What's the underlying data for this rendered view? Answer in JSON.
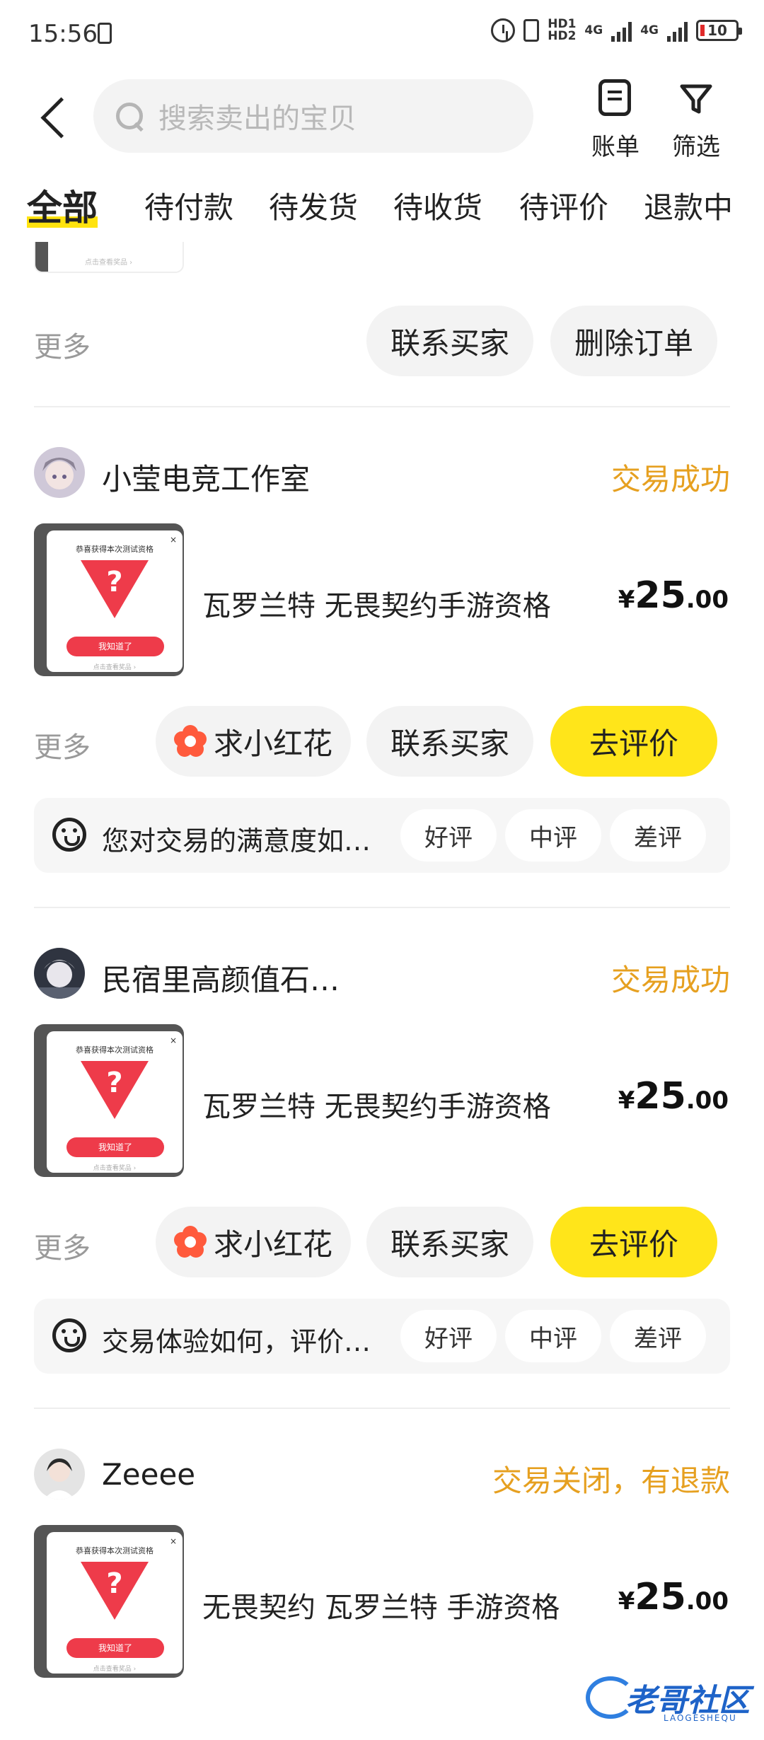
{
  "status_bar": {
    "time": "15:56",
    "hd1": "HD1",
    "hd2": "HD2",
    "net1": "4G",
    "net2": "4G",
    "battery": "10"
  },
  "header": {
    "search_placeholder": "搜索卖出的宝贝",
    "bill_label": "账单",
    "filter_label": "筛选"
  },
  "tabs": [
    {
      "label": "全部",
      "active": true
    },
    {
      "label": "待付款"
    },
    {
      "label": "待发货"
    },
    {
      "label": "待收货"
    },
    {
      "label": "待评价"
    },
    {
      "label": "退款中"
    }
  ],
  "top_partial": {
    "thumb_caption": "点击查看奖品 ›",
    "more": "更多",
    "contact": "联系买家",
    "delete": "删除订单"
  },
  "orders": [
    {
      "seller": "小莹电竞工作室",
      "status": "交易成功",
      "product": "瓦罗兰特 无畏契约手游资格",
      "price_currency": "¥",
      "price_int": "25",
      "price_dec": ".00",
      "more": "更多",
      "flower": "求小红花",
      "contact": "联系买家",
      "review_btn": "去评价",
      "review_prompt": "您对交易的满意度如…",
      "opt_good": "好评",
      "opt_mid": "中评",
      "opt_bad": "差评"
    },
    {
      "seller": "民宿里高颜值石…",
      "status": "交易成功",
      "product": "瓦罗兰特 无畏契约手游资格",
      "price_currency": "¥",
      "price_int": "25",
      "price_dec": ".00",
      "more": "更多",
      "flower": "求小红花",
      "contact": "联系买家",
      "review_btn": "去评价",
      "review_prompt": "交易体验如何，评价…",
      "opt_good": "好评",
      "opt_mid": "中评",
      "opt_bad": "差评"
    },
    {
      "seller": "Zeeee",
      "status": "交易关闭，有退款",
      "product": "无畏契约 瓦罗兰特 手游资格",
      "price_currency": "¥",
      "price_int": "25",
      "price_dec": ".00"
    }
  ],
  "thumbnail": {
    "title": "恭喜获得本次测试资格",
    "close": "×",
    "mark": "?",
    "button": "我知道了",
    "footer": "点击查看奖品 ›"
  },
  "watermark": {
    "text": "老哥社区",
    "sub": "LAOGESHEQU"
  },
  "colors": {
    "accent_yellow": "#ffe51a",
    "status_orange": "#e6a020",
    "flower_red": "#ff5a3c"
  }
}
